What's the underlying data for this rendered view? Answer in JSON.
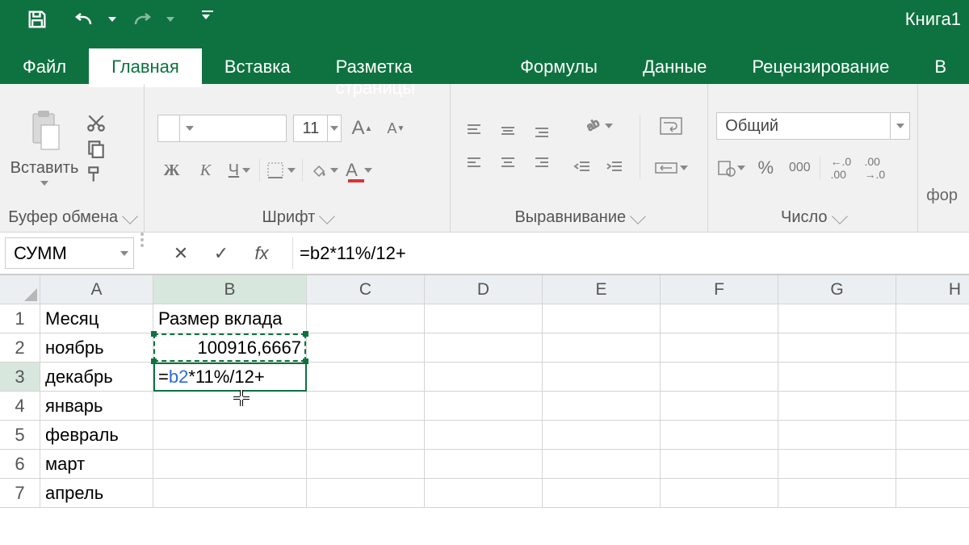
{
  "titlebar": {
    "workbook_name": "Книга1"
  },
  "tabs": {
    "file": "Файл",
    "home": "Главная",
    "insert": "Вставка",
    "page_layout": "Разметка страницы",
    "formulas": "Формулы",
    "data": "Данные",
    "review": "Рецензирование",
    "view_partial": "В"
  },
  "ribbon": {
    "clipboard": {
      "paste": "Вставить",
      "label": "Буфер обмена"
    },
    "font": {
      "size": "11",
      "bold": "Ж",
      "italic": "К",
      "underline": "Ч",
      "increase": "A",
      "decrease": "A",
      "label": "Шрифт"
    },
    "alignment": {
      "label": "Выравнивание"
    },
    "number": {
      "format": "Общий",
      "percent": "%",
      "thousands": "000",
      "label": "Число"
    },
    "editing_partial": "фор"
  },
  "formula_bar": {
    "name_box": "СУММ",
    "formula_raw": "=b2*11%/12+",
    "formula_ref": "b2",
    "formula_rest": "*11%/12+",
    "fx": "fx",
    "prefix": "="
  },
  "grid": {
    "columns": [
      "A",
      "B",
      "C",
      "D",
      "E",
      "F",
      "G",
      "H"
    ],
    "rows": [
      "1",
      "2",
      "3",
      "4",
      "5",
      "6",
      "7"
    ],
    "data": {
      "A1": "Месяц",
      "B1": "Размер вклада",
      "A2": "ноябрь",
      "B2": "100916,6667",
      "A3": "декабрь",
      "B3_prefix": "=",
      "B3_ref": "b2",
      "B3_rest": "*11%/12+",
      "A4": "январь",
      "A5": "февраль",
      "A6": "март",
      "A7": "апрель"
    }
  }
}
